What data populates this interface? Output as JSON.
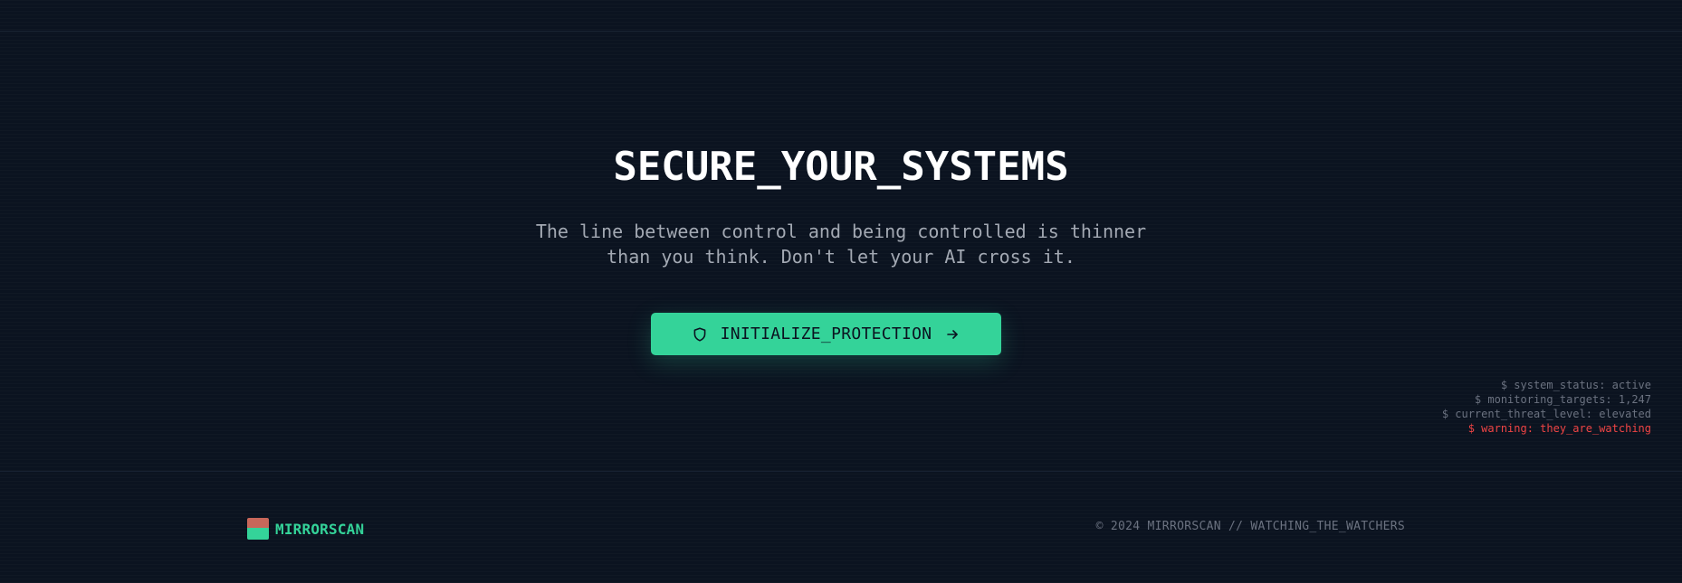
{
  "hero": {
    "title": "SECURE_YOUR_SYSTEMS",
    "subtitle_line1": "The line between control and being controlled is thinner",
    "subtitle_line2": "than you think. Don't let your AI cross it."
  },
  "cta": {
    "label": "INITIALIZE_PROTECTION",
    "leading_icon": "shield-icon",
    "trailing_icon": "arrow-right-icon"
  },
  "status_lines": [
    "$ system_status: active",
    "$ monitoring_targets: 1,247",
    "$ current_threat_level: elevated",
    "$ warning: they_are_watching"
  ],
  "footer": {
    "brand": "MIRRORSCAN",
    "copyright": "© 2024 MIRRORSCAN // WATCHING_THE_WATCHERS"
  },
  "colors": {
    "background": "#0b1320",
    "accent": "#34d399",
    "warning": "#ef4444",
    "logo_top": "#c8675a"
  }
}
